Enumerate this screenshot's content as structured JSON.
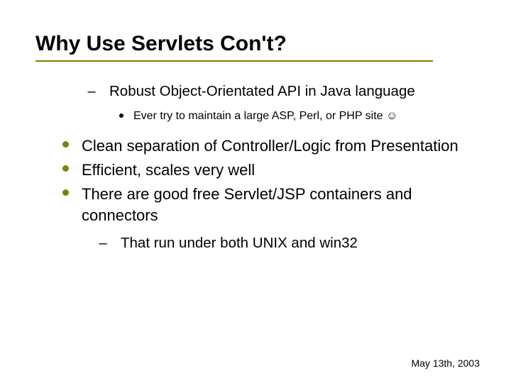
{
  "title": "Why Use Servlets Con't?",
  "sub1": {
    "text": "Robust Object-Orientated API in Java language",
    "sub": "Ever try to maintain a large ASP, Perl, or PHP site ☺"
  },
  "main": {
    "b1": "Clean separation of Controller/Logic from Presentation",
    "b2": "Efficient, scales very well",
    "b3": "There are good free Servlet/JSP containers and connectors",
    "b3sub": "That run under both UNIX and win32"
  },
  "footer": "May 13th, 2003"
}
